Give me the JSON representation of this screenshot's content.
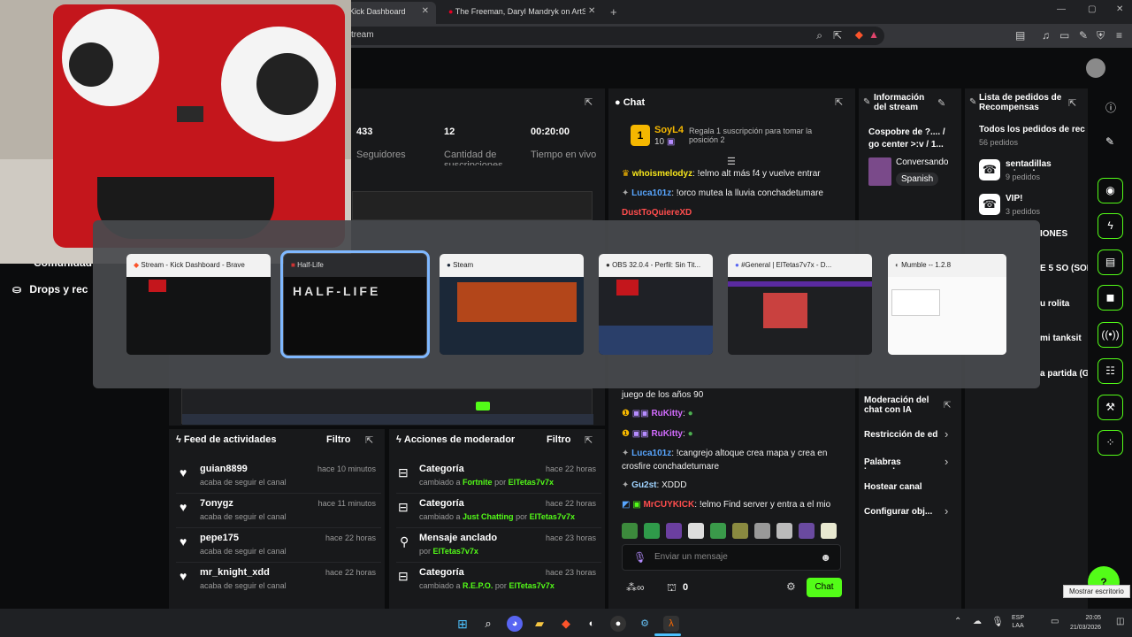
{
  "browser": {
    "tabs": [
      {
        "label": "Kick Dashboard",
        "active": true
      },
      {
        "label": "The Freeman, Daryl Mandryk on ArtS",
        "active": false
      }
    ],
    "url_text": "tream"
  },
  "stats": {
    "followers": {
      "value": "433",
      "label": "Seguidores"
    },
    "subs": {
      "value": "12",
      "label": "Cantidad de suscripciones"
    },
    "time": {
      "value": "00:20:00",
      "label": "Tiempo en vivo"
    }
  },
  "chat": {
    "title": "Chat",
    "top_user": "SoyL4",
    "top_count": "10",
    "gift_text": "Regala 1 suscripción para tomar la posición 2",
    "messages": [
      {
        "user": "whoismelodyz",
        "text": "!elmo alt más f4 y vuelve entrar",
        "color": "#f8e71c"
      },
      {
        "user": "Luca101z",
        "text": "!orco mutea la lluvia conchadetumare",
        "color": "#58a6ff"
      },
      {
        "user": "DustToQuiereXD",
        "text": "",
        "color": "#ff4d4d"
      }
    ],
    "lower_messages": [
      {
        "user": "",
        "text": "juego de los años 90",
        "color": "#eee"
      },
      {
        "user": "RuKitty",
        "text": ":",
        "color": "#d36cff"
      },
      {
        "user": "RuKitty",
        "text": ":",
        "color": "#d36cff"
      },
      {
        "user": "Luca101z",
        "text": "!cangrejo altoque crea mapa y crea en",
        "color": "#58a6ff"
      },
      {
        "user": "",
        "text": "crosfire conchadetumare",
        "color": "#eee"
      },
      {
        "user": "Gu2st",
        "text": "XDDD",
        "color": "#9fd3ff"
      },
      {
        "user": "MrCUYKICK",
        "text": "!elmo Find server y entra a el mio",
        "color": "#ff4d4d"
      }
    ],
    "input_placeholder": "Enviar un mensaje",
    "footer_count": "0",
    "send_label": "Chat"
  },
  "stream_info": {
    "title": "Información del stream",
    "stream_title": "Cospobre de ?.... / go center >:v / 1...",
    "category": "Conversando",
    "tag": "Spanish"
  },
  "rewards": {
    "title": "Lista de pedidos de Recompensas",
    "all_label": "Todos los pedidos de rec",
    "all_count": "56 pedidos",
    "items": [
      {
        "name": "sentadillas mirando",
        "count": "9 pedidos"
      },
      {
        "name": "VIP!",
        "count": "3 pedidos"
      }
    ],
    "partial": [
      "IONES",
      "E 5 SO (SOL",
      "u rolita",
      "mi tanksit",
      "a partida (G"
    ]
  },
  "left_nav": {
    "item1": "Comunidad",
    "item2": "Drops y rec"
  },
  "activity": {
    "title": "Feed de actividades",
    "filter": "Filtro",
    "items": [
      {
        "user": "guian8899",
        "action": "acaba de seguir el canal",
        "time": "hace 10 minutos"
      },
      {
        "user": "7onygz",
        "action": "acaba de seguir el canal",
        "time": "hace 11 minutos"
      },
      {
        "user": "pepe175",
        "action": "acaba de seguir el canal",
        "time": "hace 22 horas"
      },
      {
        "user": "mr_knight_xdd",
        "action": "acaba de seguir el canal",
        "time": "hace 22 horas"
      }
    ]
  },
  "mod_actions": {
    "title": "Acciones de moderador",
    "filter": "Filtro",
    "items": [
      {
        "title": "Categoría",
        "prefix": "cambiado a",
        "target": "Fortnite",
        "by": "por",
        "mod": "ElTetas7v7x",
        "time": "hace 22 horas"
      },
      {
        "title": "Categoría",
        "prefix": "cambiado a",
        "target": "Just Chatting",
        "by": "por",
        "mod": "ElTetas7v7x",
        "time": "hace 22 horas"
      },
      {
        "title": "Mensaje anclado",
        "prefix": "por",
        "target": "ElTetas7v7x",
        "by": "",
        "mod": "",
        "time": "hace 23 horas"
      },
      {
        "title": "Categoría",
        "prefix": "cambiado a",
        "target": "R.E.P.O.",
        "by": "por",
        "mod": "ElTetas7v7x",
        "time": "hace 23 horas"
      }
    ]
  },
  "moderation": {
    "items": [
      "Moderación del chat con IA",
      "Restricción de ed",
      "Palabras baneada",
      "Hostear canal",
      "Configurar obj..."
    ]
  },
  "switcher": {
    "windows": [
      {
        "title": "Stream - Kick Dashboard - Brave",
        "selected": false
      },
      {
        "title": "Half-Life",
        "selected": true
      },
      {
        "title": "Steam",
        "selected": false
      },
      {
        "title": "OBS 32.0.4 - Perfil: Sin Tit...",
        "selected": false
      },
      {
        "title": "#General | ElTetas7v7x - D...",
        "selected": false
      },
      {
        "title": "Mumble -- 1.2.8",
        "selected": false
      }
    ],
    "halflife_logo": "HALF-LIFE"
  },
  "tray": {
    "lang_top": "ESP",
    "lang_bottom": "LAA",
    "time": "20:05",
    "date": "21/03/2026",
    "tooltip": "Mostrar escritorio"
  },
  "colors": {
    "accent": "#53fc18",
    "panel": "#18191b",
    "bg": "#0b0c0d"
  }
}
